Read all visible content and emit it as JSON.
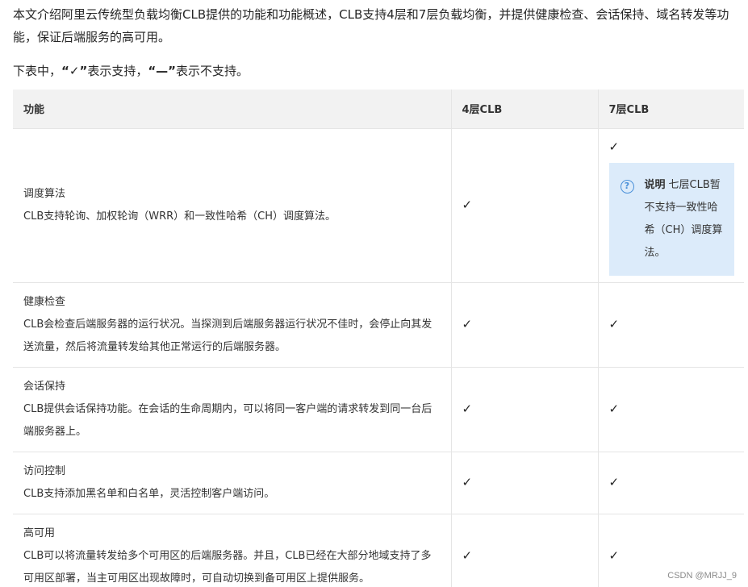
{
  "intro": "本文介绍阿里云传统型负载均衡CLB提供的功能和功能概述，CLB支持4层和7层负载均衡，并提供健康检查、会话保持、域名转发等功能，保证后端服务的高可用。",
  "legend": {
    "prefix": "下表中，",
    "check_symbol": "“✓”",
    "support_text": "表示支持，",
    "dash_symbol": "“—”",
    "no_support_text": "表示不支持。"
  },
  "table": {
    "headers": [
      "功能",
      "4层CLB",
      "7层CLB"
    ],
    "rows": [
      {
        "name": "调度算法",
        "desc": "CLB支持轮询、加权轮询（WRR）和一致性哈希（CH）调度算法。",
        "l4": "✓",
        "l7": "✓",
        "note": {
          "title": "说明",
          "text": "七层CLB暂不支持一致性哈希（CH）调度算法。"
        }
      },
      {
        "name": "健康检查",
        "desc": "CLB会检查后端服务器的运行状况。当探测到后端服务器运行状况不佳时，会停止向其发送流量，然后将流量转发给其他正常运行的后端服务器。",
        "l4": "✓",
        "l7": "✓"
      },
      {
        "name": "会话保持",
        "desc": "CLB提供会话保持功能。在会话的生命周期内，可以将同一客户端的请求转发到同一台后端服务器上。",
        "l4": "✓",
        "l7": "✓"
      },
      {
        "name": "访问控制",
        "desc": "CLB支持添加黑名单和白名单，灵活控制客户端访问。",
        "l4": "✓",
        "l7": "✓"
      },
      {
        "name": "高可用",
        "desc": "CLB可以将流量转发给多个可用区的后端服务器。并且，CLB已经在大部分地域支持了多可用区部署，当主可用区出现故障时，可自动切换到备可用区上提供服务。",
        "l4": "✓",
        "l7": "✓"
      }
    ]
  },
  "watermark": "CSDN @MRJJ_9",
  "icons": {
    "note": "help-circle-icon"
  },
  "colors": {
    "header_bg": "#f2f2f2",
    "note_bg": "#dcebfa",
    "note_icon": "#4a90d9"
  }
}
